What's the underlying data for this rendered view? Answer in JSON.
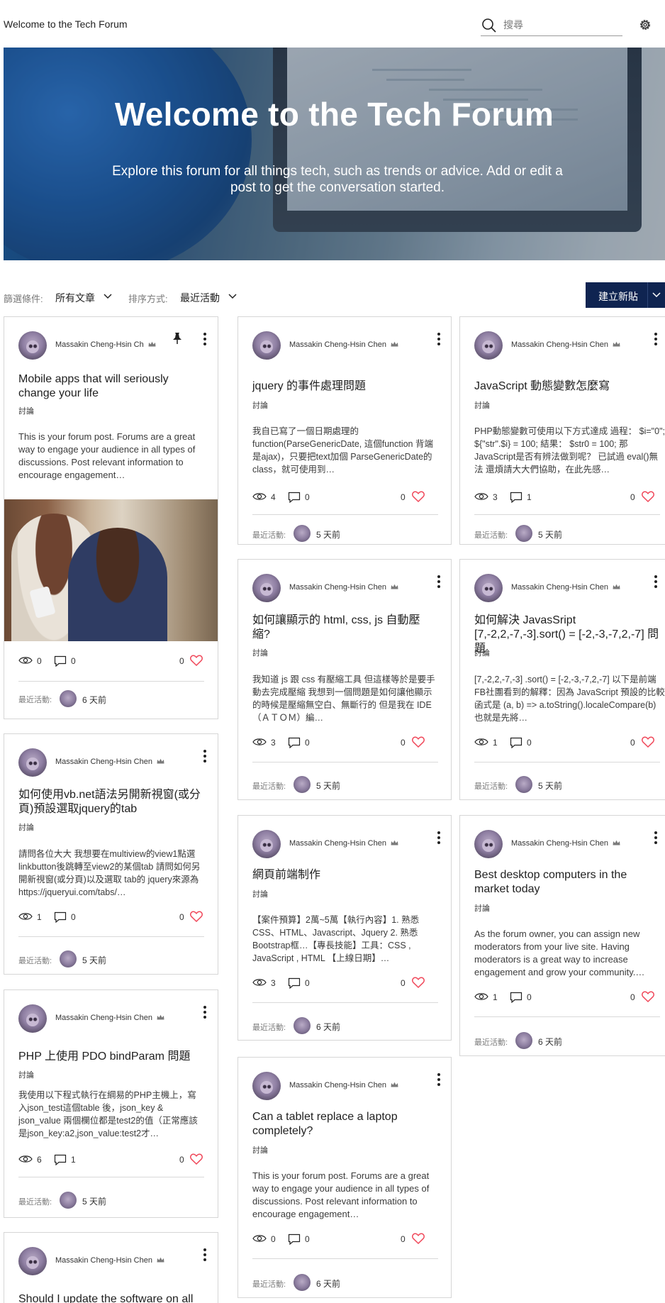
{
  "header": {
    "site_title": "Welcome to the Tech Forum",
    "search_placeholder": "搜尋"
  },
  "hero": {
    "title": "Welcome to the Tech Forum",
    "subtitle": "Explore this forum for all things tech, such as trends or advice. Add or edit a post to get the conversation started."
  },
  "filters": {
    "filter_label": "篩選條件:",
    "filter_value": "所有文章",
    "sort_label": "排序方式:",
    "sort_value": "最近活動",
    "create_button": "建立新貼"
  },
  "common": {
    "recent_label": "最近活動:"
  },
  "posts": [
    {
      "author": "Massakin Cheng-Hsin Ch",
      "pinned": true,
      "title": "Mobile apps that will seriously change your life",
      "category": "討論",
      "excerpt": "This is your forum post. Forums are a great way to engage your audience in all types of discussions. Post relevant information to encourage engagement…",
      "has_image": true,
      "views": "0",
      "comments": "0",
      "likes": "0",
      "recent": "6 天前"
    },
    {
      "author": "Massakin Cheng-Hsin Chen",
      "title": "jquery 的事件處理問題",
      "category": "討論",
      "excerpt": "我自已寫了一個日期處理的 function(ParseGenericDate, 這個function 背端是ajax)，只要把text加個 ParseGenericDate的class，就可使用到…",
      "views": "4",
      "comments": "0",
      "likes": "0",
      "recent": "5 天前"
    },
    {
      "author": "Massakin Cheng-Hsin Chen",
      "title": "JavaScript 動態變數怎麼寫",
      "category": "討論",
      "excerpt": "PHP動態變數可使用以下方式達成 過程： $i=\"0\"; ${\"str\".$i} = 100; 結果： $str0 = 100; 那JavaScript是否有辨法做到呢？ 已試過 eval()無法 還煩請大大們協助，在此先感…",
      "views": "3",
      "comments": "1",
      "likes": "0",
      "recent": "5 天前"
    },
    {
      "author": "Massakin Cheng-Hsin Chen",
      "title": "如何讓顯示的 html, css, js 自動壓縮?",
      "category": "討論",
      "excerpt": "我知道 js 跟 css 有壓縮工具 但這樣等於是要手動去完成壓縮 我想到一個問題是如何讓他顯示的時候是壓縮無空白、無斷行的 但是我在 IDE （ＡＴＯＭ）編…",
      "views": "3",
      "comments": "0",
      "likes": "0",
      "recent": "5 天前"
    },
    {
      "author": "Massakin Cheng-Hsin Chen",
      "title": "如何解決 JavasSript [7,-2,2,-7,-3].sort() = [-2,-3,-7,2,-7] 問題",
      "category": "討論",
      "excerpt": "[7,-2,2,-7,-3] .sort() = [-2,-3,-7,2,-7] 以下是前端FB社團看到的解釋：因為 JavaScript 預設的比較函式是 (a, b) => a.toString().localeCompare(b) 也就是先將…",
      "views": "1",
      "comments": "0",
      "likes": "0",
      "recent": "5 天前"
    },
    {
      "author": "Massakin Cheng-Hsin Chen",
      "title": "如何使用vb.net語法另開新視窗(或分頁)預設選取jquery的tab",
      "category": "討論",
      "excerpt": "請問各位大大 我想要在multiview的view1點選linkbutton後跳轉至view2的某個tab 請問如何另開新視窗(或分頁)以及選取 tab的 jquery來源為 https://jqueryui.com/tabs/…",
      "views": "1",
      "comments": "0",
      "likes": "0",
      "recent": "5 天前"
    },
    {
      "author": "Massakin Cheng-Hsin Chen",
      "title": "網頁前端制作",
      "category": "討論",
      "excerpt": "【案件預算】2萬~5萬【執行內容】1. 熟悉 CSS、HTML、Javascript、Jquery 2. 熟悉 Bootstrap框…【專長技能】工具：CSS , JavaScript , HTML 【上線日期】…",
      "views": "3",
      "comments": "0",
      "likes": "0",
      "recent": "6 天前"
    },
    {
      "author": "Massakin Cheng-Hsin Chen",
      "title": "Best desktop computers in the market today",
      "category": "討論",
      "excerpt": "As the forum owner, you can assign new moderators from your live site. Having moderators is a great way to increase engagement and grow your community.…",
      "views": "1",
      "comments": "0",
      "likes": "0",
      "recent": "6 天前"
    },
    {
      "author": "Massakin Cheng-Hsin Chen",
      "title": "PHP 上使用 PDO bindParam 問題",
      "category": "討論",
      "excerpt": "我使用以下程式執行在綱易的PHP主機上，寫入json_test這個table 後，json_key & json_value 兩個欄位都是test2的值（正常應該是json_key:a2,json_value:test2才…",
      "views": "6",
      "comments": "1",
      "likes": "0",
      "recent": "5 天前"
    },
    {
      "author": "Massakin Cheng-Hsin Chen",
      "title": "Can a tablet replace a laptop completely?",
      "category": "討論",
      "excerpt": "This is your forum post. Forums are a great way to engage your audience in all types of discussions. Post relevant information to encourage engagement…",
      "views": "0",
      "comments": "0",
      "likes": "0",
      "recent": "6 天前"
    },
    {
      "author": "Massakin Cheng-Hsin Chen",
      "title": "Should I update the software on all",
      "category": "",
      "excerpt": "",
      "views": "",
      "comments": "",
      "likes": "",
      "recent": ""
    }
  ],
  "colors": {
    "accent": "#0f2451",
    "heart": "#f0485a"
  }
}
